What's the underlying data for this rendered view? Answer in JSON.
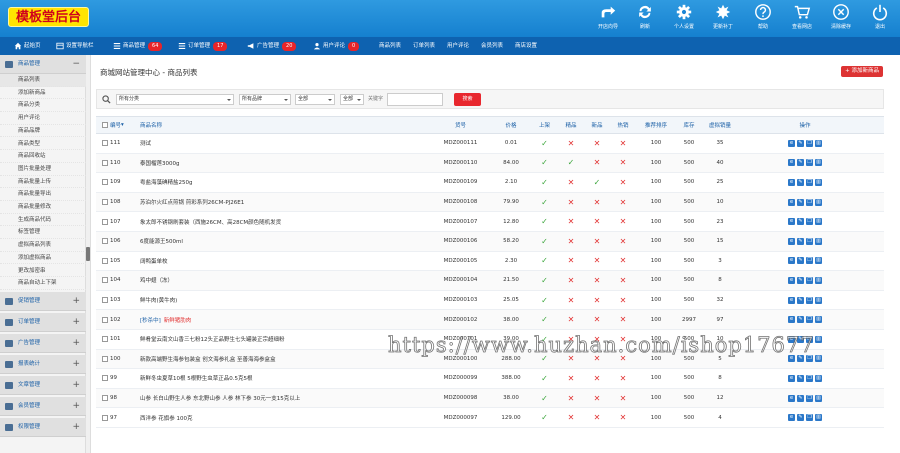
{
  "app": {
    "logo": "模板堂后台"
  },
  "toolbar": [
    {
      "label": "开店向导",
      "icon": "share-icon"
    },
    {
      "label": "刷新",
      "icon": "refresh-icon"
    },
    {
      "label": "个人设置",
      "icon": "gear-icon"
    },
    {
      "label": "更新补丁",
      "icon": "update-icon"
    },
    {
      "label": "帮助",
      "icon": "help-icon"
    },
    {
      "label": "查看网店",
      "icon": "cart-icon"
    },
    {
      "label": "清除缓存",
      "icon": "clear-icon"
    },
    {
      "label": "退出",
      "icon": "power-icon"
    }
  ],
  "nav": [
    {
      "label": "起始页"
    },
    {
      "label": "设置导航栏"
    },
    {
      "label": "商品管理",
      "badge": "64"
    },
    {
      "label": "订单管理",
      "badge": "17"
    },
    {
      "label": "广告管理",
      "badge": "20"
    },
    {
      "label": "用户评论",
      "badge": "0"
    },
    {
      "label": "商品列表"
    },
    {
      "label": "订单列表"
    },
    {
      "label": "用户评论"
    },
    {
      "label": "会员列表"
    },
    {
      "label": "商店设置"
    }
  ],
  "sidebar": {
    "groups": [
      {
        "label": "商品管理",
        "toggle": "−"
      },
      {
        "label": "促销管理",
        "toggle": "+"
      },
      {
        "label": "订单管理",
        "toggle": "+"
      },
      {
        "label": "广告管理",
        "toggle": "+"
      },
      {
        "label": "报表统计",
        "toggle": "+"
      },
      {
        "label": "文章管理",
        "toggle": "+"
      },
      {
        "label": "会员管理",
        "toggle": "+"
      },
      {
        "label": "权限管理",
        "toggle": "+"
      }
    ],
    "items": [
      "商品列表",
      "添加新商品",
      "商品分类",
      "用户评论",
      "商品品牌",
      "商品类型",
      "商品回收站",
      "图片批量处理",
      "商品批量上传",
      "商品批量导出",
      "商品批量修改",
      "生成商品代码",
      "标签管理",
      "虚拟商品列表",
      "添加虚拟商品",
      "更改加密串",
      "商品自动上下架"
    ]
  },
  "main": {
    "title": "商城网站管理中心 - 商品列表",
    "add_button": "+ 添加新商品",
    "filter": {
      "category": "所有分类",
      "brand": "所有品牌",
      "sel3": "全部",
      "sel4": "全部",
      "keyword_label": "关键字",
      "keyword_value": "",
      "search_button": "搜索"
    }
  },
  "table": {
    "headers": {
      "id": "编号",
      "name": "商品名称",
      "sn": "货号",
      "price": "价格",
      "onsale": "上架",
      "best": "精品",
      "new": "新品",
      "hot": "热销",
      "sort": "推荐排序",
      "stock": "库存",
      "virtual": "虚拟销量",
      "ops": "操作"
    },
    "rows": [
      {
        "id": "111",
        "name": "测试",
        "sn": "MDZ000111",
        "price": "0.01",
        "onsale": true,
        "best": false,
        "new": false,
        "hot": false,
        "sort": "100",
        "stock": "500",
        "virtual": "35"
      },
      {
        "id": "110",
        "name": "泰国榴莲3000g",
        "sn": "MDZ000110",
        "price": "84.00",
        "onsale": true,
        "best": true,
        "new": false,
        "hot": false,
        "sort": "100",
        "stock": "500",
        "virtual": "40"
      },
      {
        "id": "109",
        "name": "粤盐海藻碘精盐250g",
        "sn": "MDZ000109",
        "price": "2.10",
        "onsale": true,
        "best": false,
        "new": true,
        "hot": false,
        "sort": "100",
        "stock": "500",
        "virtual": "25"
      },
      {
        "id": "108",
        "name": "苏泊尔火红点煎锅 煎彩系列26CM-PJ26E1",
        "sn": "MDZ000108",
        "price": "79.90",
        "onsale": true,
        "best": false,
        "new": false,
        "hot": false,
        "sort": "100",
        "stock": "500",
        "virtual": "10"
      },
      {
        "id": "107",
        "name": "象太郎不锈钢刷套装（西施26CM、高28CM颜色随机发货",
        "sn": "MDZ000107",
        "price": "12.80",
        "onsale": true,
        "best": false,
        "new": false,
        "hot": false,
        "sort": "100",
        "stock": "500",
        "virtual": "23"
      },
      {
        "id": "106",
        "name": "6度能源王500ml",
        "sn": "MDZ000106",
        "price": "58.20",
        "onsale": true,
        "best": false,
        "new": false,
        "hot": false,
        "sort": "100",
        "stock": "500",
        "virtual": "15"
      },
      {
        "id": "105",
        "name": "阔鸭蛋单枚",
        "sn": "MDZ000105",
        "price": "2.30",
        "onsale": true,
        "best": false,
        "new": false,
        "hot": false,
        "sort": "100",
        "stock": "500",
        "virtual": "3"
      },
      {
        "id": "104",
        "name": "鸡中翅（冻）",
        "sn": "MDZ000104",
        "price": "21.50",
        "onsale": true,
        "best": false,
        "new": false,
        "hot": false,
        "sort": "100",
        "stock": "500",
        "virtual": "8"
      },
      {
        "id": "103",
        "name": "鲜牛肉(黄牛肉)",
        "sn": "MDZ000103",
        "price": "25.05",
        "onsale": true,
        "best": false,
        "new": false,
        "hot": false,
        "sort": "100",
        "stock": "500",
        "virtual": "32"
      },
      {
        "id": "102",
        "tag": "[秒杀中]",
        "name": "新鲜猪肋肉",
        "name_red": true,
        "sn": "MDZ000102",
        "price": "38.00",
        "onsale": true,
        "best": false,
        "new": false,
        "hot": false,
        "sort": "100",
        "stock": "2997",
        "virtual": "97"
      },
      {
        "id": "101",
        "name": "鲜肴堂云南文山香三七粉12头正品野生七头罐装正宗超细粉",
        "sn": "MDZ000101",
        "price": "39.00",
        "onsale": true,
        "best": false,
        "new": false,
        "hot": false,
        "sort": "100",
        "stock": "500",
        "virtual": "10"
      },
      {
        "id": "100",
        "name": "新款高端野生海参包装盒 创文海参礼盒 至善海海参盒盒",
        "sn": "MDZ000100",
        "price": "288.00",
        "onsale": true,
        "best": false,
        "new": false,
        "hot": false,
        "sort": "100",
        "stock": "500",
        "virtual": "5"
      },
      {
        "id": "99",
        "name": "新鲜冬虫夏草10根 5根野生虫草正品0.5克5根",
        "sn": "MDZ000099",
        "price": "388.00",
        "onsale": true,
        "best": false,
        "new": false,
        "hot": false,
        "sort": "100",
        "stock": "500",
        "virtual": "8"
      },
      {
        "id": "98",
        "name": "山参 长白山野生人参 东北野山参 人参 林下参 30元一支15克以上",
        "sn": "MDZ000098",
        "price": "38.00",
        "onsale": true,
        "best": false,
        "new": false,
        "hot": false,
        "sort": "100",
        "stock": "500",
        "virtual": "12"
      },
      {
        "id": "97",
        "name": "西洋参 花旗参 100克",
        "sn": "MDZ000097",
        "price": "129.00",
        "onsale": true,
        "best": false,
        "new": false,
        "hot": false,
        "sort": "100",
        "stock": "500",
        "virtual": "4"
      }
    ]
  },
  "watermark": "https://www.huzhan.com/ishop17677",
  "colors": {
    "topbar": "#1c8ad8",
    "navbar": "#0e62b0",
    "accent": "#e8272e",
    "link": "#1a5fa6",
    "check": "#3aa53a",
    "cross": "#e23535"
  }
}
